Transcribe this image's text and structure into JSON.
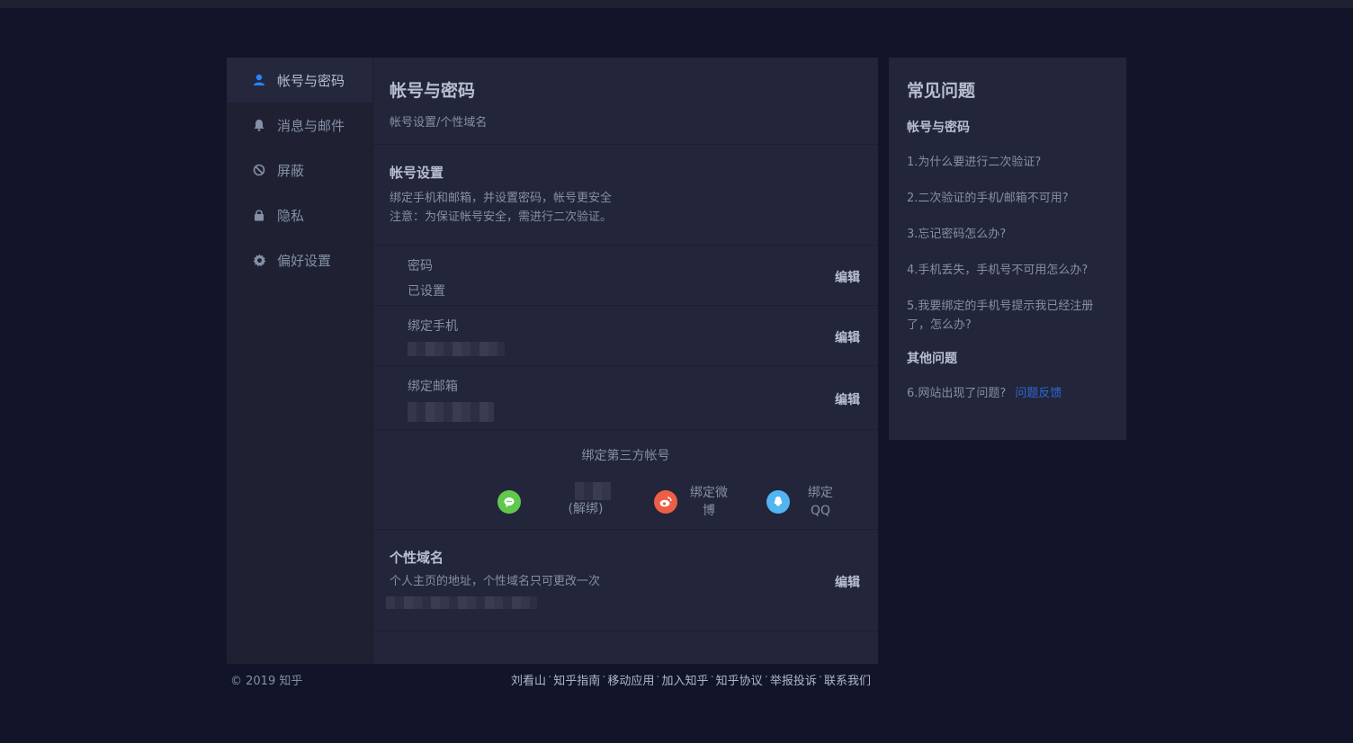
{
  "sidebar": {
    "items": [
      {
        "label": "帐号与密码",
        "icon": "user-icon",
        "active": true
      },
      {
        "label": "消息与邮件",
        "icon": "bell-icon"
      },
      {
        "label": "屏蔽",
        "icon": "block-icon"
      },
      {
        "label": "隐私",
        "icon": "lock-icon"
      },
      {
        "label": "偏好设置",
        "icon": "gear-icon"
      }
    ]
  },
  "main": {
    "title": "帐号与密码",
    "subtitle": "帐号设置/个性域名",
    "account": {
      "title": "帐号设置",
      "desc1": "绑定手机和邮箱，并设置密码，帐号更安全",
      "desc2": "注意：为保证帐号安全，需进行二次验证。",
      "rows": [
        {
          "label": "密码",
          "value": "已设置",
          "edit": "编辑"
        },
        {
          "label": "绑定手机",
          "value": "",
          "edit": "编辑"
        },
        {
          "label": "绑定邮箱",
          "value": "",
          "edit": "编辑"
        }
      ]
    },
    "third_party": {
      "title": "绑定第三方帐号",
      "wechat_label": "(解绑)",
      "weibo_label_1": "绑定微",
      "weibo_label_2": "博",
      "qq_label_1": "绑定",
      "qq_label_2": "QQ"
    },
    "domain": {
      "title": "个性域名",
      "desc": "个人主页的地址，个性域名只可更改一次",
      "edit": "编辑"
    }
  },
  "faq": {
    "title": "常见问题",
    "account_title": "帐号与密码",
    "items": [
      "1.为什么要进行二次验证?",
      "2.二次验证的手机/邮箱不可用?",
      "3.忘记密码怎么办?",
      "4.手机丢失，手机号不可用怎么办?",
      "5.我要绑定的手机号提示我已经注册了，怎么办?"
    ],
    "other_title": "其他问题",
    "other_item": "6.网站出现了问题?",
    "feedback_link": "问题反馈"
  },
  "footer": {
    "copyright": "© 2019 知乎",
    "links": [
      "刘看山",
      "知乎指南",
      "移动应用",
      "加入知乎",
      "知乎协议",
      "举报投诉",
      "联系我们"
    ],
    "separator": "·"
  },
  "colors": {
    "background": "#121429",
    "card": "#23253a",
    "accent": "#2585ff",
    "wechat": "#60c84c",
    "weibo": "#ec5e46",
    "qq": "#50b5f0"
  }
}
